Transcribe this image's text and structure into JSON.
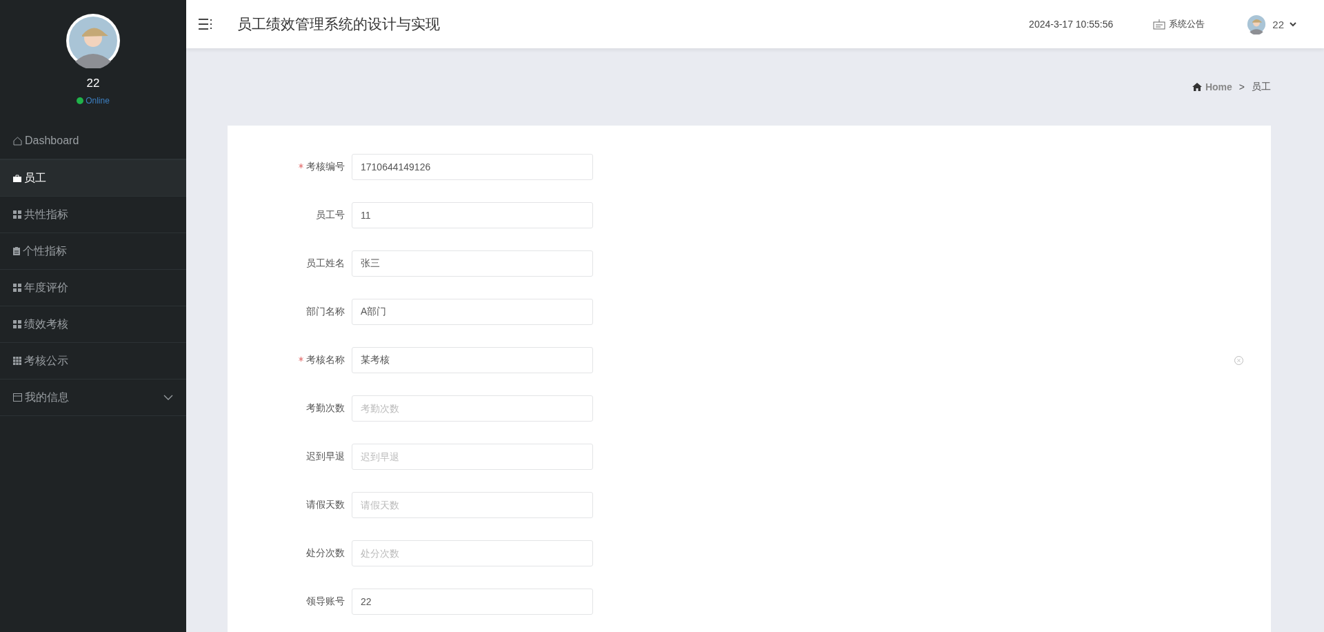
{
  "sidebar": {
    "user": {
      "name": "22",
      "status": "Online"
    },
    "items": [
      {
        "label": "Dashboard",
        "kind": "home",
        "selected": false,
        "expandable": false
      },
      {
        "label": "员工",
        "kind": "bag",
        "selected": true,
        "expandable": false
      },
      {
        "label": "共性指标",
        "kind": "grid",
        "selected": false,
        "expandable": false
      },
      {
        "label": "个性指标",
        "kind": "clipboard",
        "selected": false,
        "expandable": false
      },
      {
        "label": "年度评价",
        "kind": "grid",
        "selected": false,
        "expandable": false
      },
      {
        "label": "绩效考核",
        "kind": "grid",
        "selected": false,
        "expandable": false
      },
      {
        "label": "考核公示",
        "kind": "grid9",
        "selected": false,
        "expandable": false
      },
      {
        "label": "我的信息",
        "kind": "window",
        "selected": false,
        "expandable": true
      }
    ]
  },
  "header": {
    "title": "员工绩效管理系统的设计与实现",
    "datetime": "2024-3-17 10:55:56",
    "notice": "系统公告",
    "user": "22"
  },
  "breadcrumb": {
    "home": "Home",
    "separator": ">",
    "current": "员工"
  },
  "form": {
    "fields": [
      {
        "label": "考核编号",
        "required": true,
        "value": "1710644149126"
      },
      {
        "label": "员工号",
        "required": false,
        "value": "11"
      },
      {
        "label": "员工姓名",
        "required": false,
        "value": "张三"
      },
      {
        "label": "部门名称",
        "required": false,
        "value": "A部门"
      },
      {
        "label": "考核名称",
        "required": true,
        "value": "某考核",
        "clearable": true
      },
      {
        "label": "考勤次数",
        "required": false,
        "placeholder": "考勤次数"
      },
      {
        "label": "迟到早退",
        "required": false,
        "placeholder": "迟到早退"
      },
      {
        "label": "请假天数",
        "required": false,
        "placeholder": "请假天数"
      },
      {
        "label": "处分次数",
        "required": false,
        "placeholder": "处分次数"
      },
      {
        "label": "领导账号",
        "required": false,
        "value": "22"
      }
    ]
  }
}
